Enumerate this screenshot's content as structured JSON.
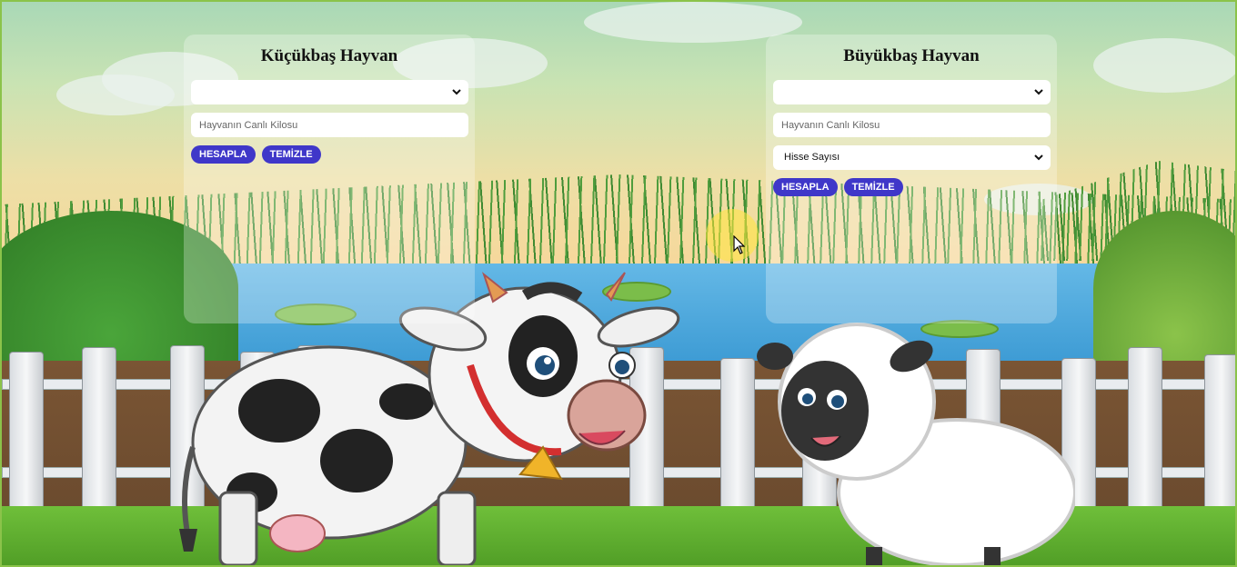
{
  "left_panel": {
    "title": "Küçükbaş Hayvan",
    "animal_select_value": "",
    "weight_placeholder": "Hayvanın Canlı Kilosu",
    "calculate_label": "HESAPLA",
    "clear_label": "TEMİZLE"
  },
  "right_panel": {
    "title": "Büyükbaş Hayvan",
    "animal_select_value": "",
    "weight_placeholder": "Hayvanın Canlı Kilosu",
    "share_select_value": "Hisse Sayısı",
    "calculate_label": "HESAPLA",
    "clear_label": "TEMİZLE"
  },
  "colors": {
    "button": "#3f37c9",
    "panel": "rgba(255,255,255,0.28)",
    "border": "#8bc34a"
  },
  "icons": {
    "select_arrow": "chevron-down-icon",
    "cursor": "mouse-pointer-icon"
  }
}
